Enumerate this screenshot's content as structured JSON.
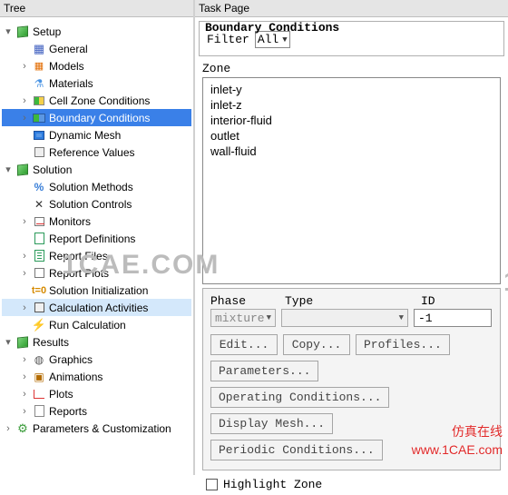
{
  "panels": {
    "tree_title": "Tree",
    "task_title": "Task Page"
  },
  "tree": [
    {
      "depth": 0,
      "twisty": "▾",
      "icon": "cube",
      "name": "setup",
      "label": "Setup",
      "interactable": true
    },
    {
      "depth": 1,
      "twisty": "",
      "icon": "page",
      "name": "general",
      "label": "General",
      "interactable": true
    },
    {
      "depth": 1,
      "twisty": "›",
      "icon": "grid",
      "name": "models",
      "label": "Models",
      "interactable": true
    },
    {
      "depth": 1,
      "twisty": "",
      "icon": "flask",
      "name": "materials",
      "label": "Materials",
      "interactable": true
    },
    {
      "depth": 1,
      "twisty": "›",
      "icon": "cell",
      "name": "cell-zone-conditions",
      "label": "Cell Zone Conditions",
      "interactable": true
    },
    {
      "depth": 1,
      "twisty": "›",
      "icon": "boundary",
      "name": "boundary-conditions",
      "label": "Boundary Conditions",
      "interactable": true,
      "selected": true
    },
    {
      "depth": 1,
      "twisty": "",
      "icon": "dynmesh",
      "name": "dynamic-mesh",
      "label": "Dynamic Mesh",
      "interactable": true
    },
    {
      "depth": 1,
      "twisty": "",
      "icon": "ref",
      "name": "reference-values",
      "label": "Reference Values",
      "interactable": true
    },
    {
      "depth": 0,
      "twisty": "▾",
      "icon": "cube",
      "name": "solution",
      "label": "Solution",
      "interactable": true
    },
    {
      "depth": 1,
      "twisty": "",
      "icon": "methods",
      "name": "solution-methods",
      "label": "Solution Methods",
      "interactable": true
    },
    {
      "depth": 1,
      "twisty": "",
      "icon": "controls",
      "name": "solution-controls",
      "label": "Solution Controls",
      "interactable": true
    },
    {
      "depth": 1,
      "twisty": "›",
      "icon": "monitor",
      "name": "monitors",
      "label": "Monitors",
      "interactable": true
    },
    {
      "depth": 1,
      "twisty": "",
      "icon": "repdef",
      "name": "report-definitions",
      "label": "Report Definitions",
      "interactable": true
    },
    {
      "depth": 1,
      "twisty": "›",
      "icon": "repfile",
      "name": "report-files",
      "label": "Report Files",
      "interactable": true
    },
    {
      "depth": 1,
      "twisty": "›",
      "icon": "repplot",
      "name": "report-plots",
      "label": "Report Plots",
      "interactable": true
    },
    {
      "depth": 1,
      "twisty": "",
      "icon": "init",
      "name": "solution-initialization",
      "label": "Solution Initialization",
      "interactable": true
    },
    {
      "depth": 1,
      "twisty": "›",
      "icon": "calc",
      "name": "calculation-activities",
      "label": "Calculation Activities",
      "interactable": true,
      "hover": true
    },
    {
      "depth": 1,
      "twisty": "",
      "icon": "run",
      "name": "run-calculation",
      "label": "Run Calculation",
      "interactable": true
    },
    {
      "depth": 0,
      "twisty": "▾",
      "icon": "cube",
      "name": "results",
      "label": "Results",
      "interactable": true
    },
    {
      "depth": 1,
      "twisty": "›",
      "icon": "graphics",
      "name": "graphics",
      "label": "Graphics",
      "interactable": true
    },
    {
      "depth": 1,
      "twisty": "›",
      "icon": "anim",
      "name": "animations",
      "label": "Animations",
      "interactable": true
    },
    {
      "depth": 1,
      "twisty": "›",
      "icon": "plots",
      "name": "plots",
      "label": "Plots",
      "interactable": true
    },
    {
      "depth": 1,
      "twisty": "›",
      "icon": "reports",
      "name": "reports",
      "label": "Reports",
      "interactable": true
    },
    {
      "depth": 0,
      "twisty": "›",
      "icon": "params",
      "name": "parameters-customization",
      "label": "Parameters & Customization",
      "interactable": true
    }
  ],
  "task": {
    "heading": "Boundary Conditions",
    "filter_label": "Filter",
    "filter_value": "All",
    "zone_label": "Zone",
    "zones": [
      "inlet-y",
      "inlet-z",
      "interior-fluid",
      "outlet",
      "wall-fluid"
    ],
    "phase_label": "Phase",
    "type_label": "Type",
    "id_label": "ID",
    "phase_value": "mixture",
    "type_value": "",
    "id_value": "-1",
    "buttons": {
      "edit": "Edit...",
      "copy": "Copy...",
      "profiles": "Profiles...",
      "parameters": "Parameters...",
      "operating": "Operating Conditions...",
      "display_mesh": "Display Mesh...",
      "periodic": "Periodic Conditions..."
    },
    "highlight_label": "Highlight Zone",
    "highlight_checked": false
  },
  "watermark": {
    "text": "1CAE.COM",
    "overlay1": "仿真在线",
    "overlay2": "www.1CAE.com"
  }
}
